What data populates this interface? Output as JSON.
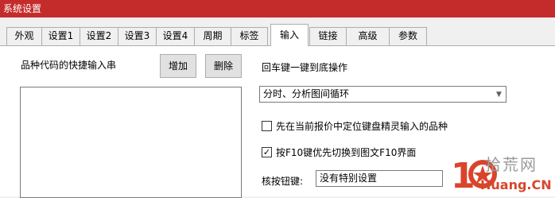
{
  "window": {
    "title": "系统设置"
  },
  "tabs": [
    {
      "label": "外观"
    },
    {
      "label": "设置1"
    },
    {
      "label": "设置2"
    },
    {
      "label": "设置3"
    },
    {
      "label": "设置4"
    },
    {
      "label": "周期"
    },
    {
      "label": "标签"
    },
    {
      "label": "输入",
      "active": true
    },
    {
      "label": "链接"
    },
    {
      "label": "高级"
    },
    {
      "label": "参数"
    }
  ],
  "left": {
    "list_label": "品种代码的快捷输入串",
    "add_button": "增加",
    "delete_button": "删除"
  },
  "right": {
    "enter_label": "回车键一键到底操作",
    "enter_select": "分时、分析图间循环",
    "checkbox1": {
      "label": "先在当前报价中定位键盘精灵输入的品种",
      "checked": false
    },
    "checkbox2": {
      "label": "按F10键优先切换到图文F10界面",
      "checked": true
    },
    "key_label": "核按钮键:",
    "key_select": "没有特别设置"
  },
  "watermark": {
    "text_cn": "拾荒网",
    "text_en": "Huang.CN"
  }
}
